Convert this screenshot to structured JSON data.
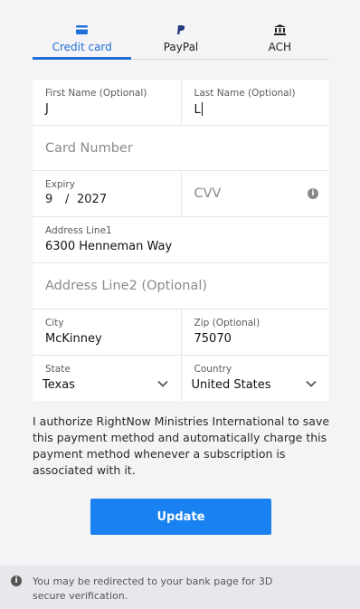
{
  "tabs": [
    {
      "label": "Credit card",
      "icon": "credit-card-icon",
      "active": true
    },
    {
      "label": "PayPal",
      "icon": "paypal-icon",
      "active": false
    },
    {
      "label": "ACH",
      "icon": "bank-icon",
      "active": false
    }
  ],
  "form": {
    "first_name": {
      "label": "First Name (Optional)",
      "value": "J"
    },
    "last_name": {
      "label": "Last Name (Optional)",
      "value": "L"
    },
    "card_number": {
      "placeholder": "Card Number"
    },
    "expiry": {
      "label": "Expiry",
      "month": "9",
      "separator": "/",
      "year": "2027"
    },
    "cvv": {
      "placeholder": "CVV"
    },
    "address1": {
      "label": "Address Line1",
      "value": "6300 Henneman Way"
    },
    "address2": {
      "placeholder": "Address Line2 (Optional)"
    },
    "city": {
      "label": "City",
      "value": "McKinney"
    },
    "zip": {
      "label": "Zip (Optional)",
      "value": "75070"
    },
    "state": {
      "label": "State",
      "value": "Texas"
    },
    "country": {
      "label": "Country",
      "value": "United States"
    }
  },
  "consent_text": "I authorize RightNow Ministries International to save this payment method and automatically charge this payment method whenever a subscription is associated with it.",
  "update_button": "Update",
  "notice": {
    "text": "You may be redirected to your bank page for 3D secure verification.",
    "icon": "info-icon"
  },
  "colors": {
    "accent": "#1f6fd6",
    "button": "#1a82f0"
  }
}
